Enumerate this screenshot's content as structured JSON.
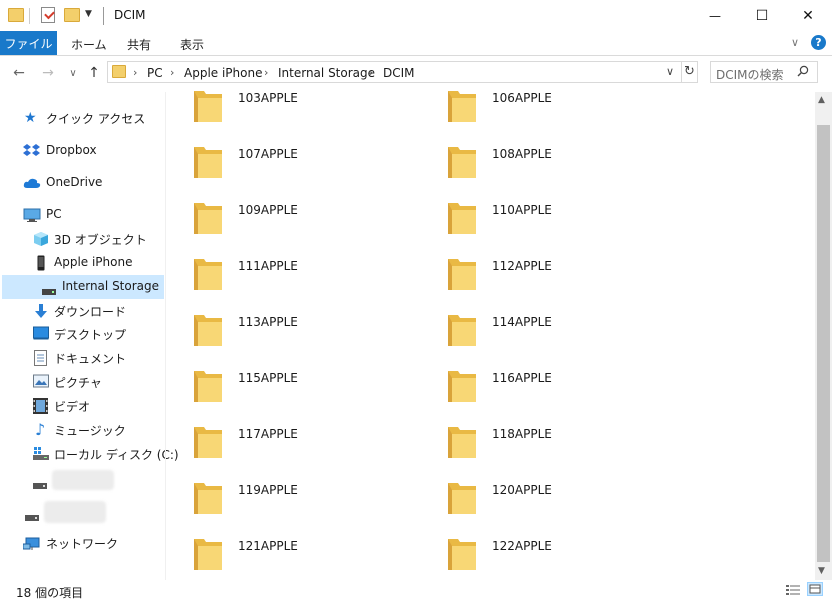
{
  "window": {
    "title": "DCIM",
    "controls": {
      "minimize": "—",
      "maximize": "☐",
      "close": "✕"
    }
  },
  "ribbon": {
    "tabs": [
      "ファイル",
      "ホーム",
      "共有",
      "表示"
    ]
  },
  "address_bar": {
    "crumbs": [
      "PC",
      "Apple iPhone",
      "Internal Storage",
      "DCIM"
    ]
  },
  "search": {
    "placeholder": "DCIMの検索"
  },
  "nav": {
    "quick_access": "クイック アクセス",
    "dropbox": "Dropbox",
    "onedrive": "OneDrive",
    "pc": "PC",
    "objects3d": "3D オブジェクト",
    "iphone": "Apple iPhone",
    "internal_storage": "Internal Storage",
    "downloads": "ダウンロード",
    "desktop": "デスクトップ",
    "documents": "ドキュメント",
    "pictures": "ピクチャ",
    "videos": "ビデオ",
    "music": "ミュージック",
    "local_disk": "ローカル ディスク (C:)",
    "network": "ネットワーク"
  },
  "files": [
    "103APPLE",
    "106APPLE",
    "107APPLE",
    "108APPLE",
    "109APPLE",
    "110APPLE",
    "111APPLE",
    "112APPLE",
    "113APPLE",
    "114APPLE",
    "115APPLE",
    "116APPLE",
    "117APPLE",
    "118APPLE",
    "119APPLE",
    "120APPLE",
    "121APPLE",
    "122APPLE"
  ],
  "status": {
    "item_count": "18 個の項目"
  },
  "colors": {
    "accent": "#1979ca",
    "folder": "#f3cf6b",
    "selection": "#cce8ff"
  }
}
